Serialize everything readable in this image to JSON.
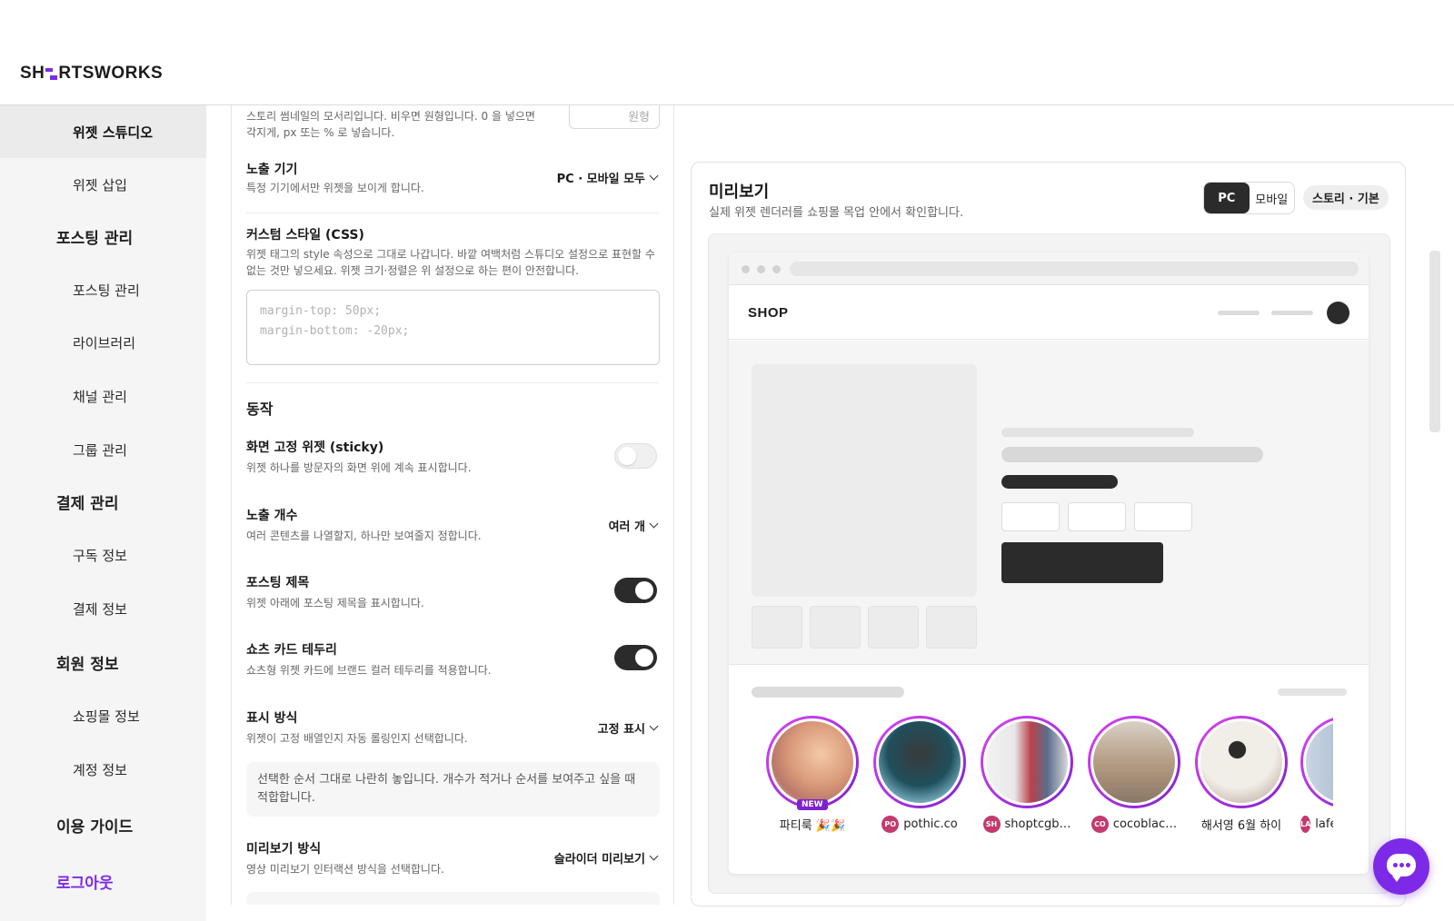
{
  "brand": {
    "logo_left": "SH",
    "logo_right": "RTSWORKS"
  },
  "sidebar": {
    "items": [
      {
        "label": "위젯 스튜디오"
      },
      {
        "label": "위젯 삽입"
      },
      {
        "label": "포스팅 관리"
      },
      {
        "label": "포스팅 관리"
      },
      {
        "label": "라이브러리"
      },
      {
        "label": "채널 관리"
      },
      {
        "label": "그룹 관리"
      },
      {
        "label": "결제 관리"
      },
      {
        "label": "구독 정보"
      },
      {
        "label": "결제 정보"
      },
      {
        "label": "회원 정보"
      },
      {
        "label": "쇼핑몰 정보"
      },
      {
        "label": "계정 정보"
      },
      {
        "label": "이용 가이드"
      }
    ],
    "logout": "로그아웃"
  },
  "settings": {
    "radius_desc": "스토리 썸네일의 모서리입니다. 비우면 원형입니다. 0 을 넣으면 각지게, px 또는 % 로 넣습니다.",
    "radius_placeholder": "원형",
    "device": {
      "label": "노출 기기",
      "desc": "특정 기기에서만 위젯을 보이게 합니다.",
      "value": "PC · 모바일 모두"
    },
    "css": {
      "label": "커스텀 스타일 (CSS)",
      "desc": "위젯 태그의 style 속성으로 그대로 나갑니다. 바깥 여백처럼 스튜디오 설정으로 표현할 수 없는 것만 넣으세요. 위젯 크기·정렬은 위 설정으로 하는 편이 안전합니다.",
      "placeholder": "margin-top: 50px;\nmargin-bottom: -20px;"
    },
    "behavior_title": "동작",
    "sticky": {
      "label": "화면 고정 위젯 (sticky)",
      "desc": "위젯 하나를 방문자의 화면 위에 계속 표시합니다.",
      "on": false
    },
    "count": {
      "label": "노출 개수",
      "desc": "여러 콘텐츠를 나열할지, 하나만 보여줄지 정합니다.",
      "value": "여러 개"
    },
    "post_title": {
      "label": "포스팅 제목",
      "desc": "위젯 아래에 포스팅 제목을 표시합니다.",
      "on": true
    },
    "card_border": {
      "label": "쇼츠 카드 테두리",
      "desc": "쇼츠형 위젯 카드에 브랜드 컬러 테두리를 적용합니다.",
      "on": true
    },
    "display": {
      "label": "표시 방식",
      "desc": "위젯이 고정 배열인지 자동 롤링인지 선택합니다.",
      "value": "고정 표시",
      "info": "선택한 순서 그대로 나란히 놓입니다. 개수가 적거나 순서를 보여주고 싶을 때 적합합니다."
    },
    "preview_mode": {
      "label": "미리보기 방식",
      "desc": "영상 미리보기 인터랙션 방식을 선택합니다.",
      "value": "슬라이더 미리보기"
    }
  },
  "preview": {
    "title": "미리보기",
    "subtitle": "실제 위젯 렌더러를 쇼핑몰 목업 안에서 확인합니다.",
    "pc_label": "PC",
    "mobile_label": "모바일",
    "style_chip": "스토리 · 기본",
    "shop_logo": "SHOP",
    "stories": [
      {
        "name": "파티룩 🎉🎉",
        "badge": "NEW",
        "avatar": ""
      },
      {
        "name": "pothic.co",
        "avatar": "PO"
      },
      {
        "name": "shoptcgb…",
        "avatar": "SH"
      },
      {
        "name": "cocoblac…",
        "avatar": "CO"
      },
      {
        "name": "해서영 6월 하이",
        "avatar": ""
      },
      {
        "name": "lafe",
        "avatar": "LA"
      }
    ]
  },
  "colors": {
    "accent": "#7d2ae8",
    "dark": "#2b2b2b"
  }
}
